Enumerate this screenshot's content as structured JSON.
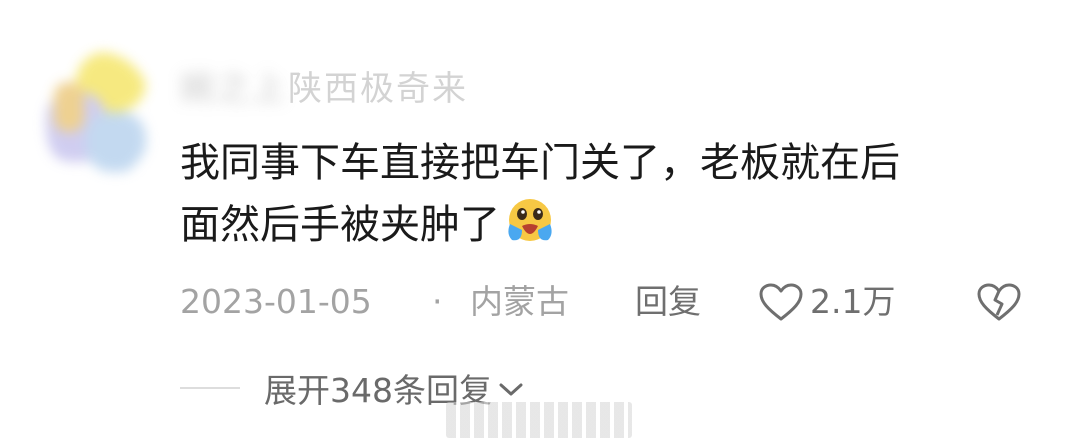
{
  "comment": {
    "username_blurred": "婉之上",
    "username_visible": "陕西极奇来",
    "text_lines": [
      "我同事下车直接把车门关了，老板就在后",
      "面然后手被夹肿了"
    ],
    "emoji": "crying-face",
    "date": "2023-01-05",
    "separator": "·",
    "location": "内蒙古",
    "reply_label": "回复",
    "like_count": "2.1万",
    "expand_replies_label": "展开348条回复"
  },
  "colors": {
    "text_primary": "#1a1a1a",
    "text_meta": "#a3a3a3",
    "text_action": "#6f6f6f",
    "emoji_face": "#f7c844",
    "emoji_tear": "#4aa8f0"
  }
}
